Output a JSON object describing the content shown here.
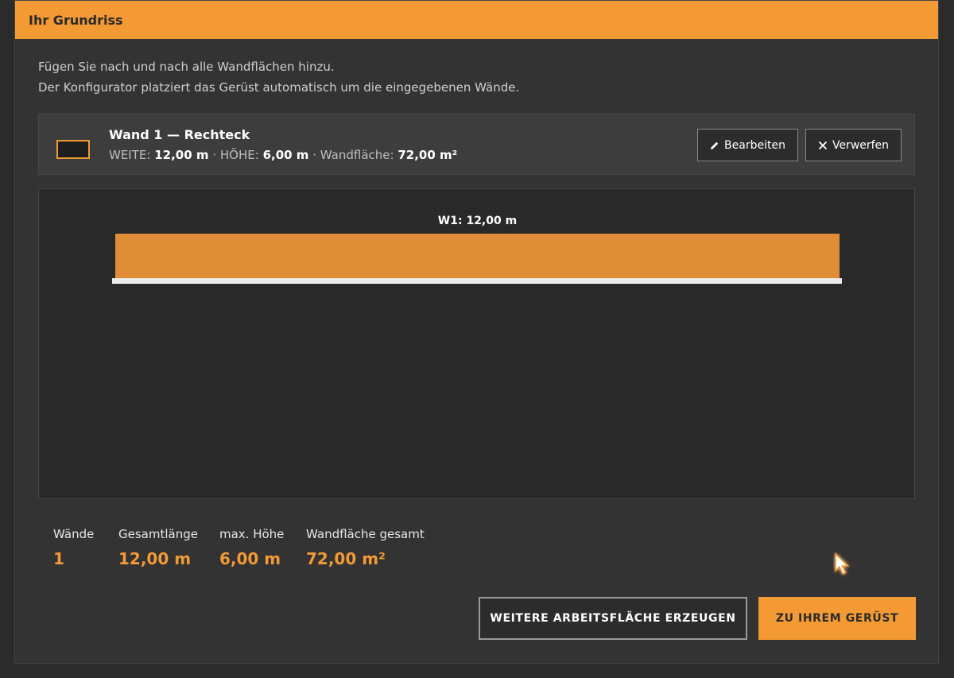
{
  "header": {
    "title": "Ihr Grundriss"
  },
  "intro": {
    "line1": "Fügen Sie nach und nach alle Wandflächen hinzu.",
    "line2": "Der Konfigurator platziert das Gerüst automatisch um die eingegebenen Wände."
  },
  "wall": {
    "title": "Wand 1 — Rechteck",
    "width_label": "WEITE:",
    "width_value": "12,00 m",
    "height_label": "HÖHE:",
    "height_value": "6,00 m",
    "area_label": "Wandfläche:",
    "area_value": "72,00 m²",
    "separator": "·",
    "edit_label": "Bearbeiten",
    "discard_label": "Verwerfen"
  },
  "canvas": {
    "wall_label": "W1: 12,00 m"
  },
  "stats": {
    "walls_label": "Wände",
    "walls_value": "1",
    "length_label": "Gesamtlänge",
    "length_value": "12,00 m",
    "height_label": "max. Höhe",
    "height_value": "6,00 m",
    "area_label": "Wandfläche gesamt",
    "area_value": "72,00 m²"
  },
  "actions": {
    "secondary_label": "WEITERE ARBEITSFLÄCHE ERZEUGEN",
    "primary_label": "ZU IHREM GERÜST"
  },
  "colors": {
    "accent": "#f39a35",
    "wall_fill": "#df8d36",
    "background": "#333333"
  },
  "icons": {
    "edit": "pencil-icon",
    "discard": "close-icon",
    "thumbnail": "rectangle-icon",
    "cursor": "pointer-cursor-icon"
  }
}
